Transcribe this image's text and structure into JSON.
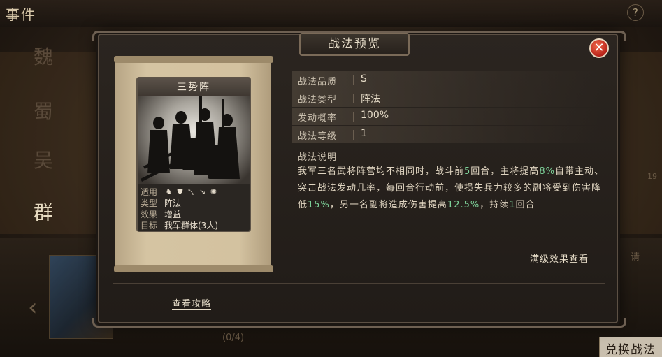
{
  "background": {
    "title": "事件",
    "help_icon": "?",
    "factions": [
      "魏",
      "蜀",
      "吴",
      "群"
    ],
    "active_faction": "群",
    "count_text": "(0/4)",
    "exchange_button": "兑换战法",
    "right_note": "请",
    "right_num": "19"
  },
  "modal": {
    "title": "战法预览",
    "close_icon": "close-icon",
    "card": {
      "name": "三势阵",
      "stats": [
        {
          "label": "适用",
          "value": ""
        },
        {
          "label": "类型",
          "value": "阵法"
        },
        {
          "label": "效果",
          "value": "增益"
        },
        {
          "label": "目标",
          "value": "我军群体(3人)"
        }
      ],
      "applicable_icons": [
        "cavalry-icon",
        "shield-icon",
        "bow-icon",
        "spear-icon",
        "siege-icon"
      ]
    },
    "info": [
      {
        "label": "战法品质",
        "value": "S"
      },
      {
        "label": "战法类型",
        "value": "阵法"
      },
      {
        "label": "发动概率",
        "value": "100%"
      },
      {
        "label": "战法等级",
        "value": "1"
      }
    ],
    "description_title": "战法说明",
    "description_parts": [
      {
        "text": "我军三名武将阵营均不相同时，战斗前",
        "hl": false
      },
      {
        "text": "5",
        "hl": true
      },
      {
        "text": "回合，主将提高",
        "hl": false
      },
      {
        "text": "8%",
        "hl": true
      },
      {
        "text": "自带主动、突击战法发动几率，每回合行动前，使损失兵力较多的副将受到伤害降低",
        "hl": false
      },
      {
        "text": "15%",
        "hl": true
      },
      {
        "text": "，另一名副将造成伤害提高",
        "hl": false
      },
      {
        "text": "12.5%",
        "hl": true
      },
      {
        "text": "，持续",
        "hl": false
      },
      {
        "text": "1",
        "hl": true
      },
      {
        "text": "回合",
        "hl": false
      }
    ],
    "full_level_link": "满级效果查看",
    "guide_link": "查看攻略"
  },
  "colors": {
    "highlight": "#7ed39a",
    "close": "#c8281d"
  }
}
